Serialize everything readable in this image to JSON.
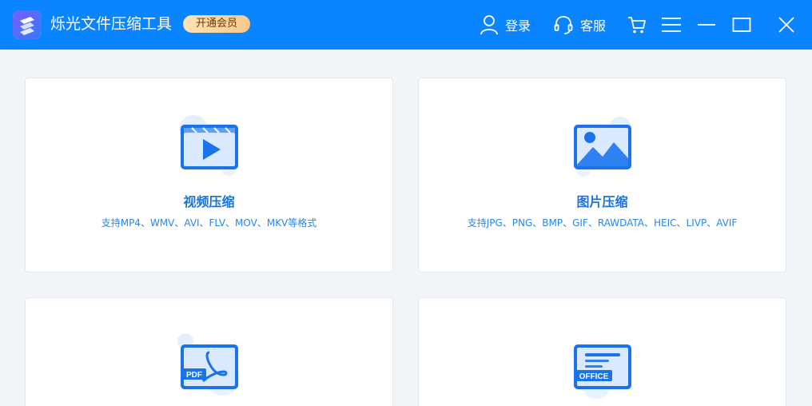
{
  "app": {
    "title": "烁光文件压缩工具",
    "vip_label": "开通会员"
  },
  "toolbar": {
    "login_label": "登录",
    "service_label": "客服"
  },
  "cards": [
    {
      "title": "视频压缩",
      "desc": "支持MP4、WMV、AVI、FLV、MOV、MKV等格式"
    },
    {
      "title": "图片压缩",
      "desc": "支持JPG、PNG、BMP、GIF、RAWDATA、HEIC、LIVP、AVIF"
    },
    {
      "badge": "PDF"
    },
    {
      "badge": "OFFICE"
    }
  ],
  "colors": {
    "titlebar": "#0a84ff",
    "accent": "#1a73d9",
    "background": "#f3f6f9"
  }
}
